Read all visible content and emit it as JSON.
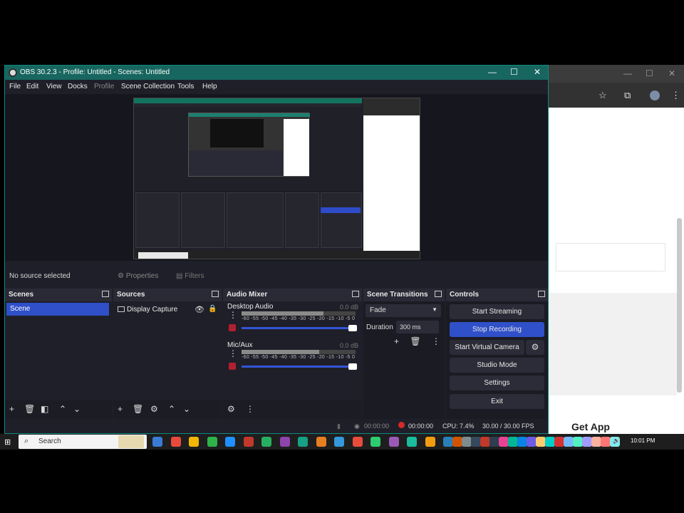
{
  "obs": {
    "title": "OBS 30.2.3 - Profile: Untitled - Scenes: Untitled",
    "menu": [
      "File",
      "Edit",
      "View",
      "Docks",
      "Profile",
      "Scene Collection",
      "Tools",
      "Help"
    ],
    "window_controls": {
      "minimize": "—",
      "maximize": "☐",
      "close": "✕"
    },
    "source_bar": {
      "no_source": "No source selected",
      "properties": "Properties",
      "filters": "Filters"
    },
    "scenes": {
      "title": "Scenes",
      "items": [
        "Scene"
      ]
    },
    "sources": {
      "title": "Sources",
      "items": [
        "Display Capture"
      ]
    },
    "mixer": {
      "title": "Audio Mixer",
      "channels": [
        {
          "name": "Desktop Audio",
          "db": "0.0 dB",
          "level": 0.72
        },
        {
          "name": "Mic/Aux",
          "db": "0.0 dB",
          "level": 0.68
        }
      ],
      "scale": "-60 -55 -50 -45 -40 -35 -30 -25 -20 -15 -10 -5 0"
    },
    "transitions": {
      "title": "Scene Transitions",
      "selected": "Fade",
      "duration_label": "Duration",
      "duration_value": "300 ms"
    },
    "controls": {
      "title": "Controls",
      "buttons": [
        "Start Streaming",
        "Stop Recording",
        "Start Virtual Camera",
        "Studio Mode",
        "Settings",
        "Exit"
      ]
    },
    "status": {
      "stream_time": "00:00:00",
      "rec_time": "00:00:00",
      "cpu": "CPU: 7.4%",
      "fps": "30.00 / 30.00 FPS"
    }
  },
  "browser": {
    "get_app": "Get App"
  },
  "taskbar": {
    "search_placeholder": "Search",
    "time": "10:01 PM"
  },
  "colors": {
    "accent": "#2f50c8",
    "titlebar": "#17665f",
    "record": "#d42a2a"
  }
}
